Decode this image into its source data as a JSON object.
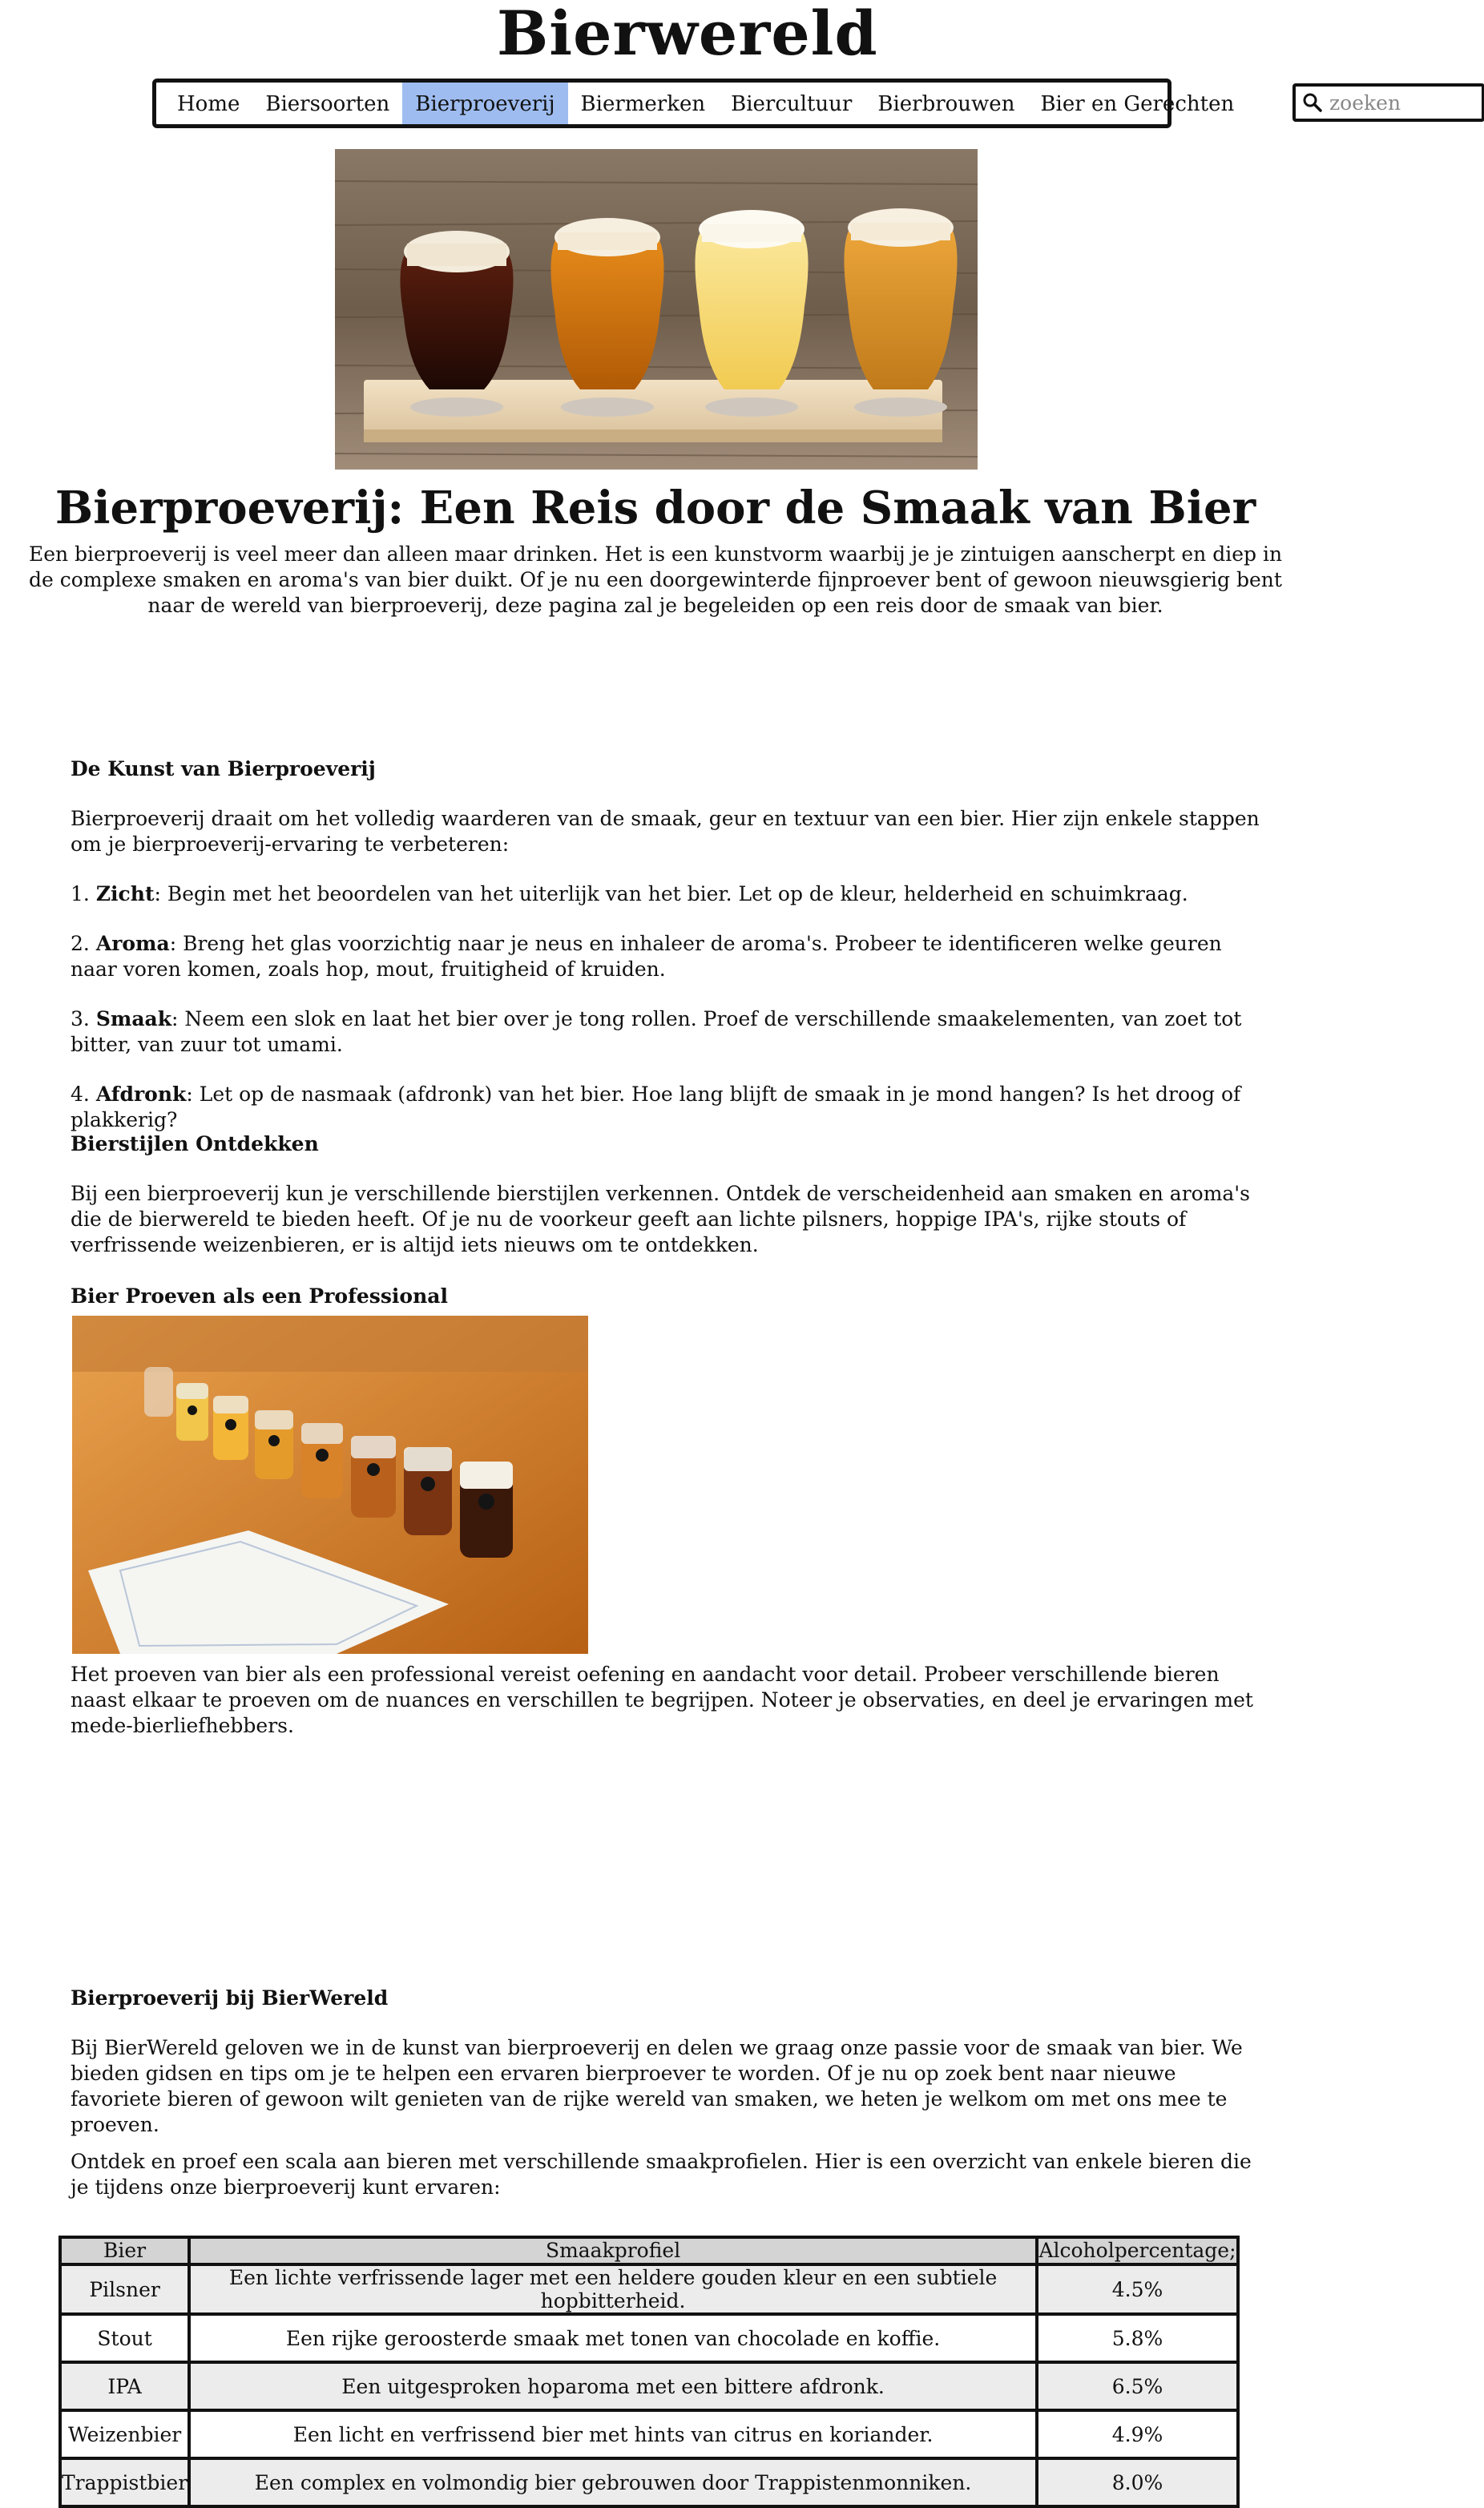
{
  "site": {
    "title": "Bierwereld"
  },
  "nav": {
    "items": [
      {
        "label": "Home"
      },
      {
        "label": "Biersoorten"
      },
      {
        "label": "Bierproeverij"
      },
      {
        "label": "Biermerken"
      },
      {
        "label": "Biercultuur"
      },
      {
        "label": "Bierbrouwen"
      },
      {
        "label": "Bier en Gerechten"
      }
    ],
    "active_index": 2
  },
  "search": {
    "placeholder": "zoeken",
    "icon": "search-icon"
  },
  "page": {
    "heading": "Bierproeverij: Een Reis door de Smaak van Bier",
    "intro": "Een bierproeverij is veel meer dan alleen maar drinken. Het is een kunstvorm waarbij je je zintuigen aanscherpt en diep in de complexe smaken en aroma's van bier duikt. Of je nu een doorgewinterde fijnproever bent of gewoon nieuwsgierig bent naar de wereld van bierproeverij, deze pagina zal je begeleiden op een reis door de smaak van bier."
  },
  "kunst": {
    "title": "De Kunst van Bierproeverij",
    "text": "Bierproeverij draait om het volledig waarderen van de smaak, geur en textuur van een bier. Hier zijn enkele stappen om je bierproeverij-ervaring te verbeteren:",
    "steps": [
      {
        "number": "1.",
        "term": "Zicht",
        "text": ": Begin met het beoordelen van het uiterlijk van het bier. Let op de kleur, helderheid en schuimkraag."
      },
      {
        "number": "2.",
        "term": "Aroma",
        "text": ": Breng het glas voorzichtig naar je neus en inhaleer de aroma's. Probeer te identificeren welke geuren naar voren komen, zoals hop, mout, fruitigheid of kruiden."
      },
      {
        "number": "3.",
        "term": "Smaak",
        "text": ": Neem een slok en laat het bier over je tong rollen. Proef de verschillende smaakelementen, van zoet tot bitter, van zuur tot umami."
      },
      {
        "number": "4.",
        "term": "Afdronk",
        "text": ": Let op de nasmaak (afdronk) van het bier. Hoe lang blijft de smaak in je mond hangen? Is het droog of plakkerig?"
      }
    ]
  },
  "stijlen": {
    "title": "Bierstijlen Ontdekken",
    "text": "Bij een bierproeverij kun je verschillende bierstijlen verkennen. Ontdek de verscheidenheid aan smaken en aroma's die de bierwereld te bieden heeft. Of je nu de voorkeur geeft aan lichte pilsners, hoppige IPA's, rijke stouts of verfrissende weizenbieren, er is altijd iets nieuws om te ontdekken."
  },
  "professional": {
    "title": "Bier Proeven als een Professional",
    "text": "Het proeven van bier als een professional vereist oefening en aandacht voor detail. Probeer verschillende bieren naast elkaar te proeven om de nuances en verschillen te begrijpen. Noteer je observaties, en deel je ervaringen met mede-bierliefhebbers."
  },
  "bierwereld": {
    "title": "Bierproeverij bij BierWereld",
    "text1": "Bij BierWereld geloven we in de kunst van bierproeverij en delen we graag onze passie voor de smaak van bier. We bieden gidsen en tips om je te helpen een ervaren bierproever te worden. Of je nu op zoek bent naar nieuwe favoriete bieren of gewoon wilt genieten van de rijke wereld van smaken, we heten je welkom om met ons mee te proeven.",
    "text2": "Ontdek en proef een scala aan bieren met verschillende smaakprofielen. Hier is een overzicht van enkele bieren die je tijdens onze bierproeverij kunt ervaren:"
  },
  "table": {
    "headers": [
      "Bier",
      "Smaakprofiel",
      "Alcoholpercentage;"
    ],
    "rows": [
      [
        "Pilsner",
        "Een lichte verfrissende lager met een heldere gouden kleur en een subtiele hopbitterheid.",
        "4.5%"
      ],
      [
        "Stout",
        "Een rijke  geroosterde smaak met tonen van chocolade en koffie.",
        "5.8%"
      ],
      [
        "IPA",
        "Een uitgesproken hoparoma met een bittere afdronk.",
        "6.5%"
      ],
      [
        "Weizenbier",
        "Een licht en verfrissend bier met hints van citrus en koriander.",
        "4.9%"
      ],
      [
        "Trappistbier",
        "Een complex en volmondig bier gebrouwen door Trappistenmonniken.",
        "8.0%"
      ]
    ]
  },
  "colors": {
    "nav_active": "#9ebcf0",
    "table_header": "#d4d4d4",
    "table_row_alt": "#ececec"
  }
}
